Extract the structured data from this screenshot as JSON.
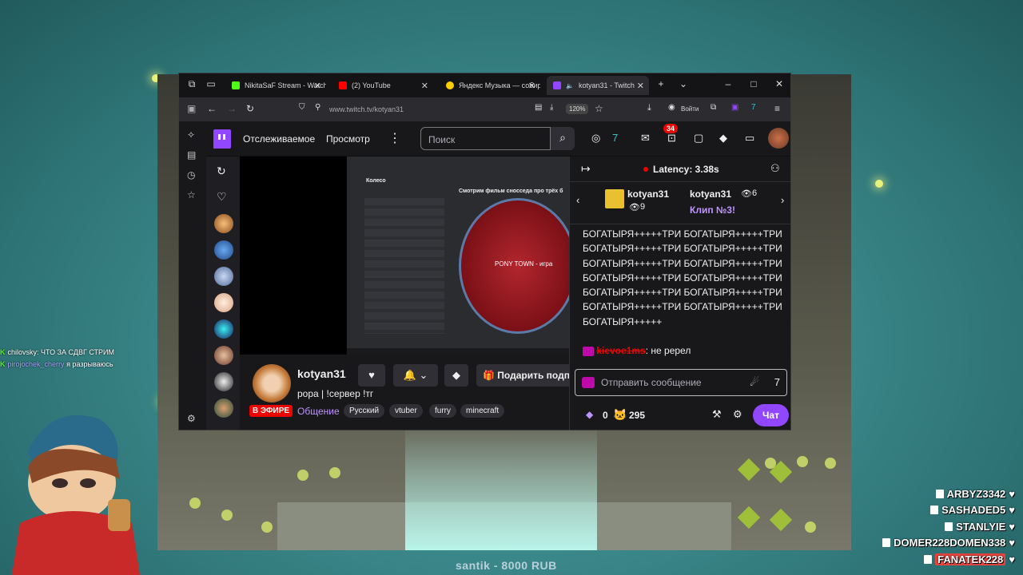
{
  "browser": {
    "tabs": [
      {
        "label": "NikitaSaF Stream - Watch",
        "icon": "kick-icon",
        "color": "#53fc18"
      },
      {
        "label": "(2) YouTube",
        "icon": "youtube-icon",
        "color": "#ff0000"
      },
      {
        "label": "Яндекс Музыка — собир",
        "icon": "yandex-music-icon",
        "color": "#ffcc00"
      },
      {
        "label": "kotyan31 - Twitch",
        "icon": "twitch-icon",
        "color": "#9147ff"
      }
    ],
    "url": "www.twitch.tv/kotyan31",
    "zoom": "120%",
    "login_label": "Войти"
  },
  "twitch": {
    "nav": {
      "following": "Отслеживаемое",
      "browse": "Просмотр",
      "search_placeholder": "Поиск",
      "notifications_count": "34"
    },
    "stream": {
      "channel": "kotyan31",
      "title": "рора | !сервер !тг",
      "category": "Общение",
      "live_label": "В ЭФИРЕ",
      "tags": [
        "Русский",
        "vtuber",
        "furry",
        "minecraft"
      ],
      "gift_label": "Подарить подп",
      "video": {
        "panel_title": "Колесо",
        "heading": "Смотрим фильм сносседа про трёх б",
        "wheel_label": "PONY TOWN - игра"
      }
    },
    "chat": {
      "latency": "Latency: 3.38s",
      "pinned": {
        "user1": "kotyan31",
        "views1": "9",
        "user2": "kotyan31",
        "views2": "6",
        "clip": "Клип №3!"
      },
      "spam_lines": [
        "БОГАТЫРЯ+++++ТРИ БОГАТЫРЯ+++++ТРИ",
        "БОГАТЫРЯ+++++ТРИ БОГАТЫРЯ+++++ТРИ",
        "БОГАТЫРЯ+++++ТРИ БОГАТЫРЯ+++++ТРИ",
        "БОГАТЫРЯ+++++ТРИ БОГАТЫРЯ+++++ТРИ",
        "БОГАТЫРЯ+++++ТРИ БОГАТЫРЯ+++++ТРИ",
        "БОГАТЫРЯ+++++ТРИ БОГАТЫРЯ+++++ТРИ",
        "БОГАТЫРЯ+++++"
      ],
      "message": {
        "user": "kievoe1ms",
        "text": ": не ререл"
      },
      "input_placeholder": "Отправить сообщение",
      "points": "0",
      "viewers": "295",
      "chat_button": "Чат"
    }
  },
  "overlay": {
    "chat": [
      {
        "user": "chilovsky",
        "text": ": ЧТО ЗА СДВГ СТРИМ"
      },
      {
        "user": "pirojochek_cherry",
        "text": "я разрываюсь"
      }
    ],
    "donation": "santik - 8000 RUB",
    "subs": [
      "ARBYZ3342",
      "SASHADED5",
      "STANLYIE",
      "DOMER228DOMEN338",
      "FANATEK228"
    ]
  }
}
